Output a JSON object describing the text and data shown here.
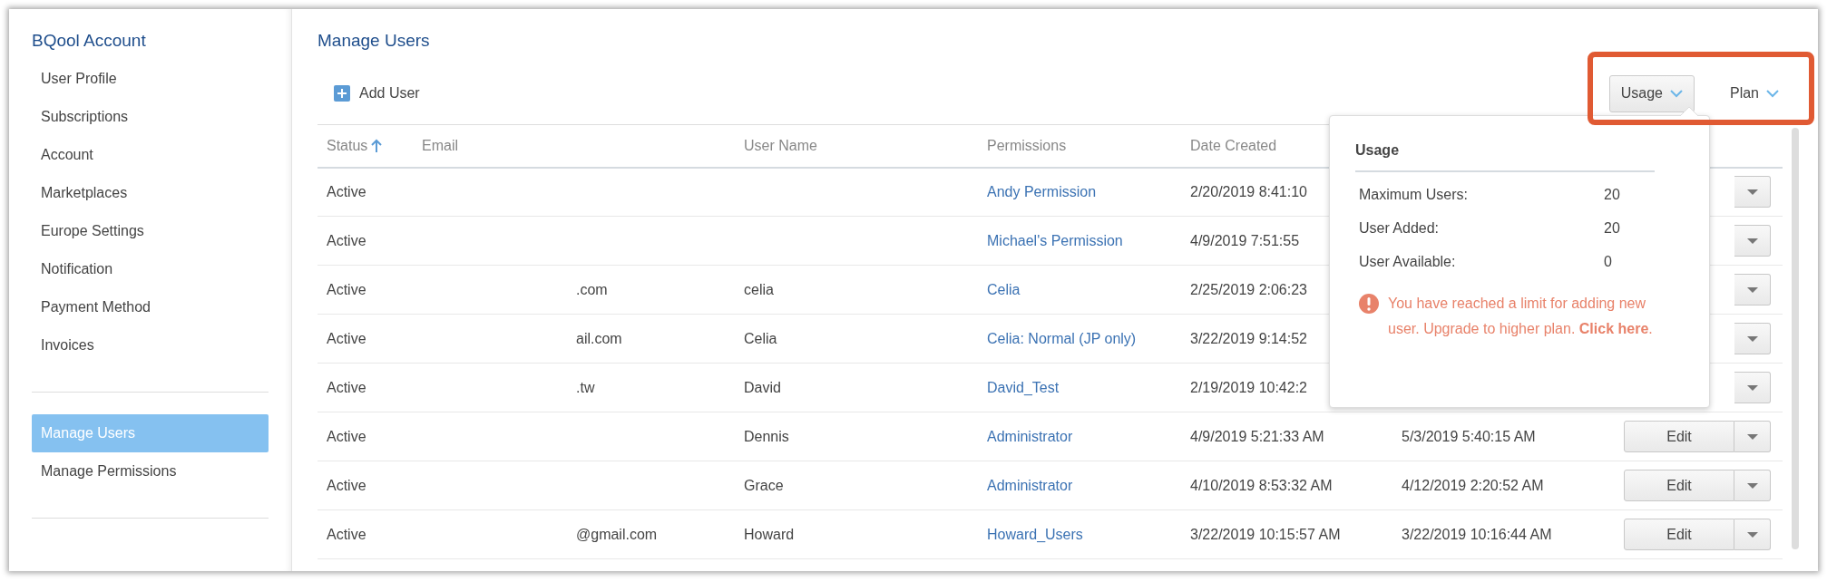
{
  "sidebar": {
    "title": "BQool Account",
    "groups": [
      {
        "items": [
          {
            "label": "User Profile",
            "selected": false
          },
          {
            "label": "Subscriptions",
            "selected": false
          },
          {
            "label": "Account",
            "selected": false
          },
          {
            "label": "Marketplaces",
            "selected": false
          },
          {
            "label": "Europe Settings",
            "selected": false
          },
          {
            "label": "Notification",
            "selected": false
          },
          {
            "label": "Payment Method",
            "selected": false
          },
          {
            "label": "Invoices",
            "selected": false
          }
        ]
      },
      {
        "items": [
          {
            "label": "Manage Users",
            "selected": true
          },
          {
            "label": "Manage Permissions",
            "selected": false
          }
        ]
      }
    ]
  },
  "main": {
    "title": "Manage Users",
    "add_button": "Add User"
  },
  "toolbar": [
    {
      "label": "Usage",
      "expanded": true
    },
    {
      "label": "Plan",
      "expanded": false
    }
  ],
  "table": {
    "columns": [
      {
        "label": "Status",
        "sorted_ascending": true
      },
      {
        "label": "Email"
      },
      {
        "label": "User Name"
      },
      {
        "label": "Permissions"
      },
      {
        "label": "Date Created"
      }
    ],
    "rows": [
      {
        "status": "Active",
        "permissions": "Andy Permission",
        "date_created": "2/20/2019 8:41:10"
      },
      {
        "status": "Active",
        "permissions": "Michael's Permission",
        "date_created": "4/9/2019 7:51:55"
      },
      {
        "status": "Active",
        "email": ".com",
        "user_name": "celia",
        "permissions": "Celia",
        "date_created": "2/25/2019 2:06:23"
      },
      {
        "status": "Active",
        "email": "ail.com",
        "user_name": "Celia",
        "permissions": "Celia: Normal (JP only)",
        "date_created": "3/22/2019 9:14:52"
      },
      {
        "status": "Active",
        "email": ".tw",
        "user_name": "David",
        "permissions": "David_Test",
        "date_created": "2/19/2019 10:42:2"
      },
      {
        "status": "Active",
        "user_name": "Dennis",
        "permissions": "Administrator",
        "date_created": "4/9/2019 5:21:33 AM",
        "date_modified": "5/3/2019 5:40:15 AM",
        "action": "Edit"
      },
      {
        "status": "Active",
        "user_name": "Grace",
        "permissions": "Administrator",
        "date_created": "4/10/2019 8:53:32 AM",
        "date_modified": "4/12/2019 2:20:52 AM",
        "action": "Edit"
      },
      {
        "status": "Active",
        "email": "@gmail.com",
        "user_name": "Howard",
        "permissions": "Howard_Users",
        "date_created": "3/22/2019 10:15:57 AM",
        "date_modified": "3/22/2019 10:16:44 AM",
        "action": "Edit"
      }
    ]
  },
  "usage_popover": {
    "title": "Usage",
    "stats": [
      {
        "label": "Maximum Users:",
        "value": "20"
      },
      {
        "label": "User Added:",
        "value": "20"
      },
      {
        "label": "User Available:",
        "value": "0"
      }
    ],
    "warning": "You have reached a limit for adding new user. Upgrade to higher plan. **Click here**."
  }
}
